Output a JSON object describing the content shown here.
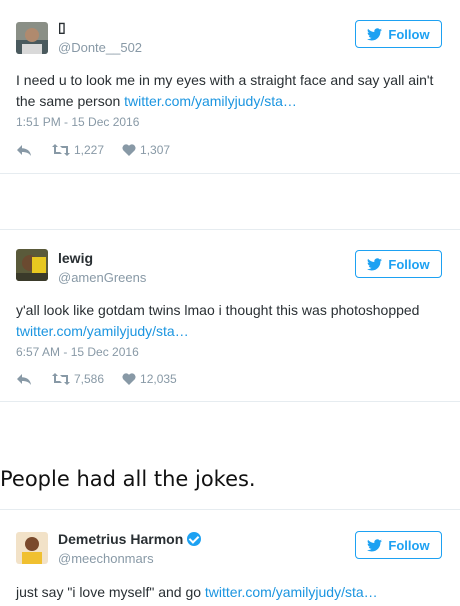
{
  "tweets": [
    {
      "name": "▯",
      "handle": "@Donte__502",
      "follow_label": "Follow",
      "text": "I need u to look me in my eyes with a straight face and say yall ain't the same person ",
      "link": "twitter.com/yamilyjudy/sta…",
      "timestamp": "1:51 PM - 15 Dec 2016",
      "retweets": "1,227",
      "likes": "1,307"
    },
    {
      "name": "lewig",
      "handle": "@amenGreens",
      "follow_label": "Follow",
      "text": "y'all look like gotdam twins lmao i thought this was photoshopped ",
      "link": "twitter.com/yamilyjudy/sta…",
      "timestamp": "6:57 AM - 15 Dec 2016",
      "retweets": "7,586",
      "likes": "12,035"
    },
    {
      "name": "Demetrius Harmon",
      "handle": "@meechonmars",
      "follow_label": "Follow",
      "verified": true,
      "text": "just say \"i love myself\" and go ",
      "link": "twitter.com/yamilyjudy/sta…"
    }
  ],
  "article": {
    "heading": "People had all the jokes."
  },
  "colors": {
    "accent": "#1da1f2",
    "link": "#1b95e0",
    "muted": "#8899a6",
    "text": "#292f33",
    "divider": "#e6ecf0"
  },
  "icons": {
    "follow": "twitter-bird-icon",
    "reply": "reply-icon",
    "retweet": "retweet-icon",
    "like": "heart-icon",
    "verified": "verified-badge-icon"
  }
}
